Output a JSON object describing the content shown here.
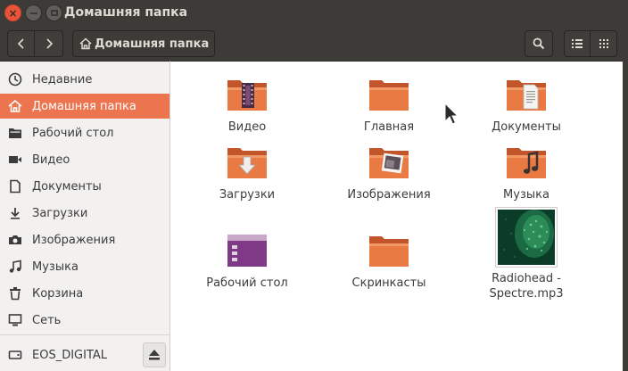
{
  "window": {
    "title": "Домашняя папка"
  },
  "toolbar": {
    "breadcrumb": "Домашняя папка"
  },
  "sidebar": {
    "items": [
      {
        "label": "Недавние",
        "icon": "clock-icon"
      },
      {
        "label": "Домашняя папка",
        "icon": "home-icon"
      },
      {
        "label": "Рабочий стол",
        "icon": "folder-icon"
      },
      {
        "label": "Видео",
        "icon": "video-icon"
      },
      {
        "label": "Документы",
        "icon": "document-icon"
      },
      {
        "label": "Загрузки",
        "icon": "download-icon"
      },
      {
        "label": "Изображения",
        "icon": "camera-icon"
      },
      {
        "label": "Музыка",
        "icon": "music-icon"
      },
      {
        "label": "Корзина",
        "icon": "trash-icon"
      },
      {
        "label": "Сеть",
        "icon": "network-icon"
      }
    ],
    "device": {
      "label": "EOS_DIGITAL",
      "icon": "drive-icon"
    }
  },
  "files": [
    {
      "name": "Видео",
      "kind": "folder-video"
    },
    {
      "name": "Главная",
      "kind": "folder"
    },
    {
      "name": "Документы",
      "kind": "folder-documents"
    },
    {
      "name": "Загрузки",
      "kind": "folder-downloads"
    },
    {
      "name": "Изображения",
      "kind": "folder-pictures"
    },
    {
      "name": "Музыка",
      "kind": "folder-music"
    },
    {
      "name": "Рабочий стол",
      "kind": "folder-desktop"
    },
    {
      "name": "Скринкасты",
      "kind": "folder"
    },
    {
      "name": "Radiohead - Spectre.mp3",
      "kind": "audio-file-thumbnail"
    }
  ],
  "colors": {
    "accent": "#ec7550",
    "folder": "#e9713f",
    "chrome": "#3c3b37"
  }
}
